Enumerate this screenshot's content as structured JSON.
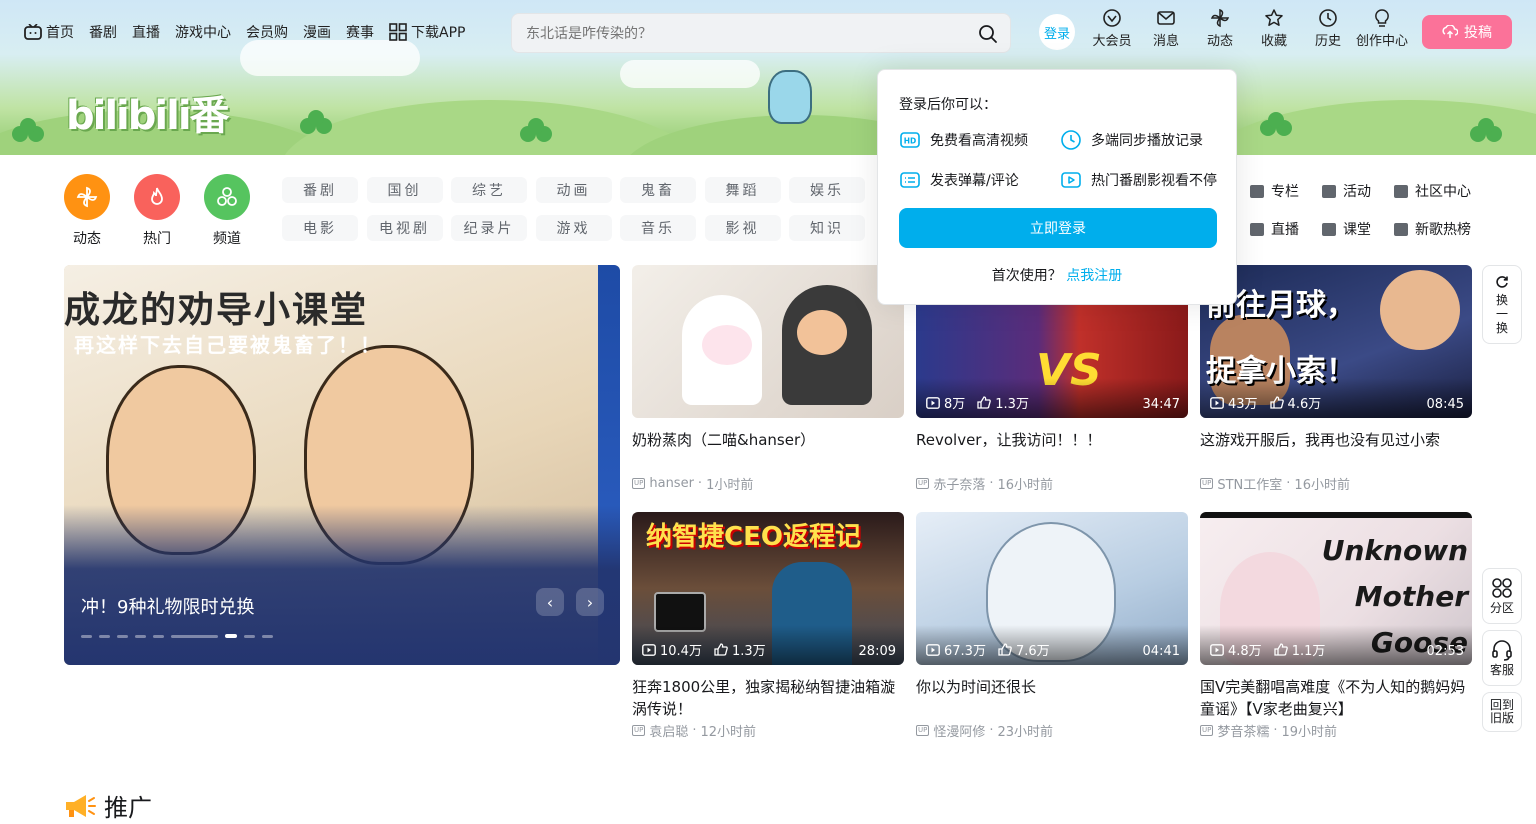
{
  "nav": {
    "items": [
      "首页",
      "番剧",
      "直播",
      "游戏中心",
      "会员购",
      "漫画",
      "赛事"
    ],
    "download": "下载APP"
  },
  "search": {
    "placeholder": "东北话是咋传染的？"
  },
  "header": {
    "login": "登录",
    "icons": [
      "大会员",
      "消息",
      "动态",
      "收藏",
      "历史",
      "创作中心"
    ],
    "upload": "投稿"
  },
  "banner": {
    "logo_text": "bilibili番"
  },
  "channels": {
    "main": [
      "动态",
      "热门",
      "频道"
    ],
    "chips": [
      "番剧",
      "国创",
      "综艺",
      "动画",
      "鬼畜",
      "舞蹈",
      "娱乐",
      "电影",
      "电视剧",
      "纪录片",
      "游戏",
      "音乐",
      "影视",
      "知识"
    ],
    "extra": [
      "专栏",
      "活动",
      "社区中心",
      "直播",
      "课堂",
      "新歌热榜"
    ]
  },
  "carousel": {
    "art_title": "成龙的劝导小课堂",
    "art_subtitle": "再这样下去自己要被鬼畜了！！",
    "caption": "冲！9种礼物限时兑换"
  },
  "videos": [
    {
      "title": "奶粉蒸肉（二喵&hanser）",
      "author": "hanser",
      "time": "1小时前",
      "plays": "",
      "likes": "",
      "duration": ""
    },
    {
      "title": "Revolver，让我访问！！！",
      "author": "赤子奈落",
      "time": "16小时前",
      "plays": "8万",
      "likes": "1.3万",
      "duration": "34:47",
      "art_text": "VS"
    },
    {
      "title": "这游戏开服后，我再也没有见过小索",
      "author": "STN工作室",
      "time": "16小时前",
      "plays": "43万",
      "likes": "4.6万",
      "duration": "08:45",
      "art_text": "前往月球，捉拿小索！"
    },
    {
      "title": "狂奔1800公里，独家揭秘纳智捷油箱漩涡传说！",
      "author": "袁启聪",
      "time": "12小时前",
      "plays": "10.4万",
      "likes": "1.3万",
      "duration": "28:09",
      "art_text": "纳智捷CEO返程记"
    },
    {
      "title": "你以为时间还很长",
      "author": "怪漫阿修",
      "time": "23小时前",
      "plays": "67.3万",
      "likes": "7.6万",
      "duration": "04:41"
    },
    {
      "title": "国V完美翻唱高难度《不为人知的鹅妈妈童谣》【V家老曲复兴】",
      "author": "梦音茶糯",
      "time": "19小时前",
      "plays": "4.8万",
      "likes": "1.1万",
      "duration": "02:53",
      "art_text": "Unknown Mother Goose"
    }
  ],
  "popup": {
    "heading": "登录后你可以：",
    "perks": [
      "免费看高清视频",
      "多端同步播放记录",
      "发表弹幕/评论",
      "热门番剧影视看不停"
    ],
    "button": "立即登录",
    "register_prefix": "首次使用？",
    "register_link": "点我注册"
  },
  "side": {
    "refresh": "换一换",
    "zone": "分区",
    "service": "客服",
    "old": "回到旧版"
  },
  "section": {
    "promo": "推广"
  },
  "colors": {
    "accent": "#00aeec",
    "pink": "#fb7299",
    "dynamic": "#ff9212",
    "hot": "#f9625c",
    "channel": "#56c45f"
  }
}
